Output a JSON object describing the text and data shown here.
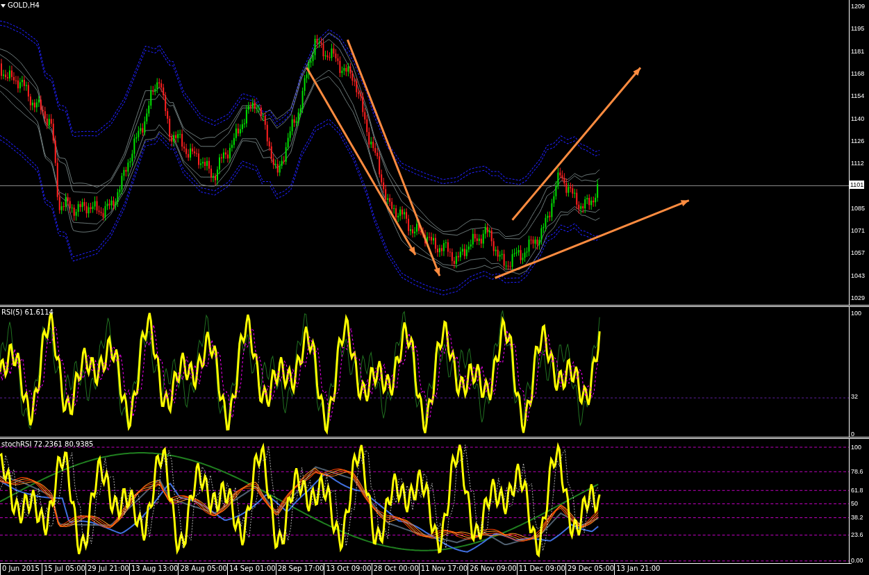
{
  "chart": {
    "title": "GOLD,H4"
  },
  "price_axis": {
    "labels": [
      "1209",
      "1195",
      "1181",
      "1168",
      "1154",
      "1140",
      "1126",
      "1112",
      "1085",
      "1071",
      "1057",
      "1043",
      "1029"
    ],
    "current_price": "1101"
  },
  "rsi_pane": {
    "title": "RSI(5) 61.6114",
    "labels": [
      "100",
      "32",
      "0"
    ]
  },
  "stoch_pane": {
    "title": "stochRSI 72.2361 80.9385",
    "labels": [
      "100",
      "78.6",
      "61.8",
      "50",
      "38.2",
      "23.6",
      "0.00"
    ]
  },
  "time_axis": {
    "labels": [
      "0 Jun 2015",
      "15 Jul 05:00",
      "29 Jul 21:00",
      "13 Aug 13:00",
      "28 Aug 05:00",
      "14 Sep 01:00",
      "28 Sep 17:00",
      "13 Oct 09:00",
      "28 Oct 00:00",
      "11 Nov 17:00",
      "26 Nov 09:00",
      "11 Dec 09:00",
      "29 Dec 05:00",
      "13 Jan 21:00"
    ]
  }
}
